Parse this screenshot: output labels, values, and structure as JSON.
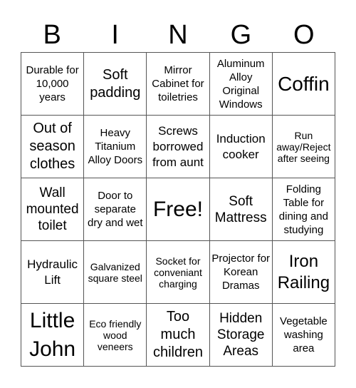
{
  "header": {
    "letters": [
      "B",
      "I",
      "N",
      "G",
      "O"
    ]
  },
  "board": {
    "rows": [
      [
        "Durable for 10,000 years",
        "Soft padding",
        "Mirror Cabinet for toiletries",
        "Aluminum Alloy Original Windows",
        "Coffin"
      ],
      [
        "Out of season clothes",
        "Heavy Titanium Alloy Doors",
        "Screws borrowed from aunt",
        "Induction cooker",
        "Run away/Reject after seeing"
      ],
      [
        "Wall mounted toilet",
        "Door to separate dry and wet",
        "Free!",
        "Soft Mattress",
        "Folding Table for dining and studying"
      ],
      [
        "Hydraulic Lift",
        "Galvanized square steel",
        "Socket for conveniant charging",
        "Projector for Korean Dramas",
        "Iron Railing"
      ],
      [
        "Little John",
        "Eco friendly wood veneers",
        "Too much children",
        "Hidden Storage Areas",
        "Vegetable washing area"
      ]
    ]
  }
}
